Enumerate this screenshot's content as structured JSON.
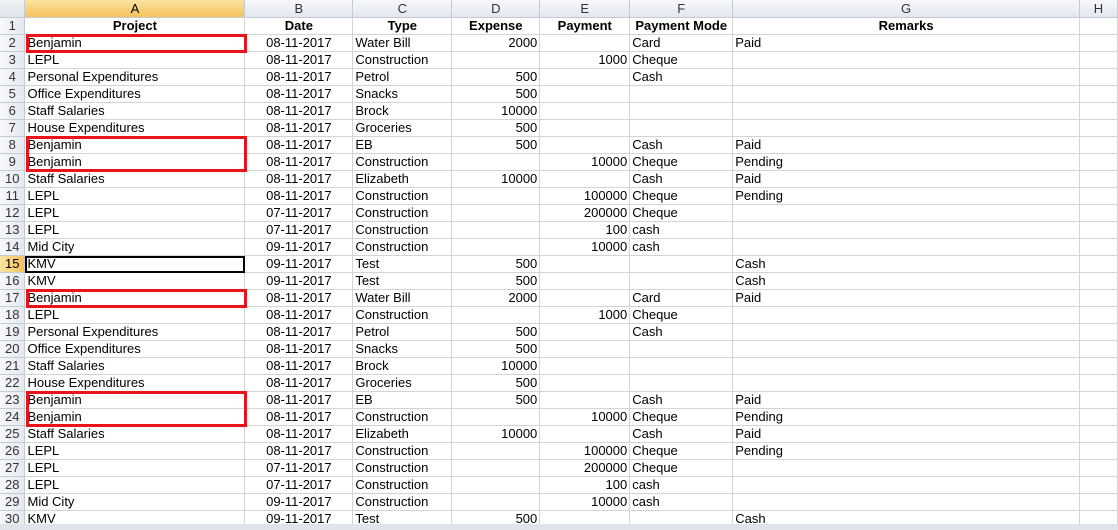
{
  "columns": [
    "A",
    "B",
    "C",
    "D",
    "E",
    "F",
    "G",
    "H"
  ],
  "selected_column": "A",
  "selected_row": 15,
  "headers": {
    "project": "Project",
    "date": "Date",
    "type": "Type",
    "expense": "Expense",
    "payment": "Payment",
    "mode": "Payment Mode",
    "remarks": "Remarks"
  },
  "rows": [
    {
      "n": 2,
      "project": "Benjamin",
      "date": "08-11-2017",
      "type": "Water Bill",
      "expense": "2000",
      "payment": "",
      "mode": "Card",
      "remarks": "Paid"
    },
    {
      "n": 3,
      "project": "LEPL",
      "date": "08-11-2017",
      "type": "Construction",
      "expense": "",
      "payment": "1000",
      "mode": "Cheque",
      "remarks": ""
    },
    {
      "n": 4,
      "project": "Personal Expenditures",
      "date": "08-11-2017",
      "type": "Petrol",
      "expense": "500",
      "payment": "",
      "mode": "Cash",
      "remarks": ""
    },
    {
      "n": 5,
      "project": "Office Expenditures",
      "date": "08-11-2017",
      "type": "Snacks",
      "expense": "500",
      "payment": "",
      "mode": "",
      "remarks": ""
    },
    {
      "n": 6,
      "project": "Staff Salaries",
      "date": "08-11-2017",
      "type": "Brock",
      "expense": "10000",
      "payment": "",
      "mode": "",
      "remarks": ""
    },
    {
      "n": 7,
      "project": "House Expenditures",
      "date": "08-11-2017",
      "type": "Groceries",
      "expense": "500",
      "payment": "",
      "mode": "",
      "remarks": ""
    },
    {
      "n": 8,
      "project": "Benjamin",
      "date": "08-11-2017",
      "type": "EB",
      "expense": "500",
      "payment": "",
      "mode": "Cash",
      "remarks": "Paid"
    },
    {
      "n": 9,
      "project": "Benjamin",
      "date": "08-11-2017",
      "type": "Construction",
      "expense": "",
      "payment": "10000",
      "mode": "Cheque",
      "remarks": "Pending"
    },
    {
      "n": 10,
      "project": "Staff Salaries",
      "date": "08-11-2017",
      "type": "Elizabeth",
      "expense": "10000",
      "payment": "",
      "mode": "Cash",
      "remarks": "Paid"
    },
    {
      "n": 11,
      "project": "LEPL",
      "date": "08-11-2017",
      "type": "Construction",
      "expense": "",
      "payment": "100000",
      "mode": "Cheque",
      "remarks": "Pending"
    },
    {
      "n": 12,
      "project": "LEPL",
      "date": "07-11-2017",
      "type": "Construction",
      "expense": "",
      "payment": "200000",
      "mode": "Cheque",
      "remarks": ""
    },
    {
      "n": 13,
      "project": "LEPL",
      "date": "07-11-2017",
      "type": "Construction",
      "expense": "",
      "payment": "100",
      "mode": "cash",
      "remarks": ""
    },
    {
      "n": 14,
      "project": "Mid City",
      "date": "09-11-2017",
      "type": "Construction",
      "expense": "",
      "payment": "10000",
      "mode": "cash",
      "remarks": ""
    },
    {
      "n": 15,
      "project": "KMV",
      "date": "09-11-2017",
      "type": "Test",
      "expense": "500",
      "payment": "",
      "mode": "",
      "remarks": "Cash"
    },
    {
      "n": 16,
      "project": "KMV",
      "date": "09-11-2017",
      "type": "Test",
      "expense": "500",
      "payment": "",
      "mode": "",
      "remarks": "Cash"
    },
    {
      "n": 17,
      "project": "Benjamin",
      "date": "08-11-2017",
      "type": "Water Bill",
      "expense": "2000",
      "payment": "",
      "mode": "Card",
      "remarks": "Paid"
    },
    {
      "n": 18,
      "project": "LEPL",
      "date": "08-11-2017",
      "type": "Construction",
      "expense": "",
      "payment": "1000",
      "mode": "Cheque",
      "remarks": ""
    },
    {
      "n": 19,
      "project": "Personal Expenditures",
      "date": "08-11-2017",
      "type": "Petrol",
      "expense": "500",
      "payment": "",
      "mode": "Cash",
      "remarks": ""
    },
    {
      "n": 20,
      "project": "Office Expenditures",
      "date": "08-11-2017",
      "type": "Snacks",
      "expense": "500",
      "payment": "",
      "mode": "",
      "remarks": ""
    },
    {
      "n": 21,
      "project": "Staff Salaries",
      "date": "08-11-2017",
      "type": "Brock",
      "expense": "10000",
      "payment": "",
      "mode": "",
      "remarks": ""
    },
    {
      "n": 22,
      "project": "House Expenditures",
      "date": "08-11-2017",
      "type": "Groceries",
      "expense": "500",
      "payment": "",
      "mode": "",
      "remarks": ""
    },
    {
      "n": 23,
      "project": "Benjamin",
      "date": "08-11-2017",
      "type": "EB",
      "expense": "500",
      "payment": "",
      "mode": "Cash",
      "remarks": "Paid"
    },
    {
      "n": 24,
      "project": "Benjamin",
      "date": "08-11-2017",
      "type": "Construction",
      "expense": "",
      "payment": "10000",
      "mode": "Cheque",
      "remarks": "Pending"
    },
    {
      "n": 25,
      "project": "Staff Salaries",
      "date": "08-11-2017",
      "type": "Elizabeth",
      "expense": "10000",
      "payment": "",
      "mode": "Cash",
      "remarks": "Paid"
    },
    {
      "n": 26,
      "project": "LEPL",
      "date": "08-11-2017",
      "type": "Construction",
      "expense": "",
      "payment": "100000",
      "mode": "Cheque",
      "remarks": "Pending"
    },
    {
      "n": 27,
      "project": "LEPL",
      "date": "07-11-2017",
      "type": "Construction",
      "expense": "",
      "payment": "200000",
      "mode": "Cheque",
      "remarks": ""
    },
    {
      "n": 28,
      "project": "LEPL",
      "date": "07-11-2017",
      "type": "Construction",
      "expense": "",
      "payment": "100",
      "mode": "cash",
      "remarks": ""
    },
    {
      "n": 29,
      "project": "Mid City",
      "date": "09-11-2017",
      "type": "Construction",
      "expense": "",
      "payment": "10000",
      "mode": "cash",
      "remarks": ""
    },
    {
      "n": 30,
      "project": "KMV",
      "date": "09-11-2017",
      "type": "Test",
      "expense": "500",
      "payment": "",
      "mode": "",
      "remarks": "Cash"
    }
  ],
  "highlights": [
    {
      "from": 2,
      "to": 2
    },
    {
      "from": 8,
      "to": 9
    },
    {
      "from": 17,
      "to": 17
    },
    {
      "from": 23,
      "to": 24
    }
  ],
  "colors": {
    "highlight": "#e8131b",
    "selection_header": "#f6c25a",
    "gridline": "#d4d4d4"
  }
}
